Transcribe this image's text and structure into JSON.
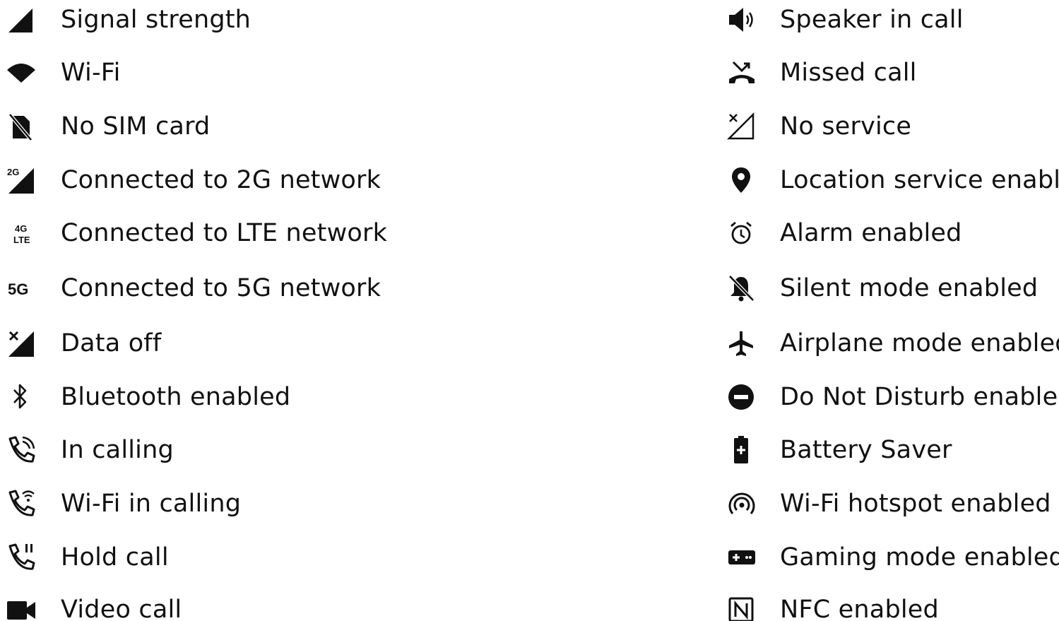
{
  "left_column": [
    {
      "icon": "signal-strength-icon",
      "label": "Signal strength"
    },
    {
      "icon": "wifi-icon",
      "label": "Wi-Fi"
    },
    {
      "icon": "no-sim-card-icon",
      "label": "No SIM card"
    },
    {
      "icon": "network-2g-icon",
      "label": "Connected to 2G network"
    },
    {
      "icon": "network-4g-lte-icon",
      "label": "Connected to LTE network"
    },
    {
      "icon": "network-5g-icon",
      "label": "Connected to 5G network"
    },
    {
      "icon": "data-off-icon",
      "label": "Data off"
    },
    {
      "icon": "bluetooth-icon",
      "label": "Bluetooth enabled"
    },
    {
      "icon": "in-call-icon",
      "label": "In calling"
    },
    {
      "icon": "wifi-calling-icon",
      "label": "Wi-Fi in calling"
    },
    {
      "icon": "hold-call-icon",
      "label": "Hold call"
    },
    {
      "icon": "video-call-icon",
      "label": "Video call"
    }
  ],
  "right_column": [
    {
      "icon": "speaker-icon",
      "label": "Speaker in call"
    },
    {
      "icon": "missed-call-icon",
      "label": "Missed call"
    },
    {
      "icon": "no-service-icon",
      "label": "No service"
    },
    {
      "icon": "location-pin-icon",
      "label": "Location service enabled"
    },
    {
      "icon": "alarm-clock-icon",
      "label": "Alarm enabled"
    },
    {
      "icon": "bell-off-icon",
      "label": "Silent mode enabled"
    },
    {
      "icon": "airplane-icon",
      "label": "Airplane mode enabled"
    },
    {
      "icon": "do-not-disturb-icon",
      "label": "Do Not Disturb enabled"
    },
    {
      "icon": "battery-saver-icon",
      "label": "Battery Saver"
    },
    {
      "icon": "hotspot-icon",
      "label": "Wi-Fi hotspot enabled"
    },
    {
      "icon": "gamepad-icon",
      "label": "Gaming mode enabled"
    },
    {
      "icon": "nfc-icon",
      "label": "NFC enabled"
    }
  ],
  "icon_badges": {
    "network_2g": "2G",
    "network_4g": "4G",
    "network_lte": "LTE",
    "network_5g": "5G"
  },
  "colors": {
    "icon": "#111111",
    "text": "#111111",
    "background": "#ffffff"
  }
}
